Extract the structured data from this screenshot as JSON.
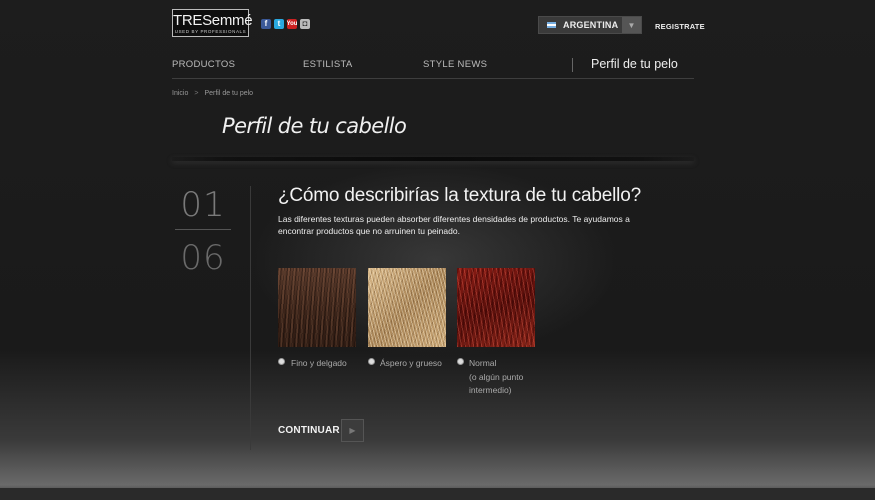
{
  "header": {
    "logo_text": "TRESemmé",
    "logo_tagline": "USED BY PROFESSIONALS",
    "social": [
      {
        "icon": "facebook-icon",
        "glyph": "f"
      },
      {
        "icon": "twitter-icon",
        "glyph": "t"
      },
      {
        "icon": "youtube-icon",
        "glyph": "You"
      },
      {
        "icon": "instagram-icon",
        "glyph": "◘"
      }
    ],
    "country": "ARGENTINA",
    "country_dropdown_glyph": "▼",
    "register_label": "REGISTRATE"
  },
  "nav": {
    "items": [
      "PRODUCTOS",
      "ESTILISTA",
      "STYLE NEWS"
    ],
    "active_section": "Perfil de tu pelo"
  },
  "breadcrumb": {
    "home": "Inicio",
    "separator": ">",
    "current": "Perfil de tu pelo"
  },
  "page": {
    "title": "Perfil de tu cabello"
  },
  "step": {
    "current": "01",
    "total": "06"
  },
  "question": {
    "title": "¿Cómo describirías la textura de tu cabello?",
    "description": "Las diferentes texturas pueden absorber diferentes densidades de productos. Te ayudamos a encontrar productos que no arruinen tu peinado."
  },
  "options": [
    {
      "label": "Fino y delgado"
    },
    {
      "label": "Áspero y grueso"
    },
    {
      "label_lines": [
        "Normal",
        "(o algún punto",
        "intermedio)"
      ]
    }
  ],
  "continue": {
    "label": "CONTINUAR",
    "button_glyph": "▶"
  }
}
